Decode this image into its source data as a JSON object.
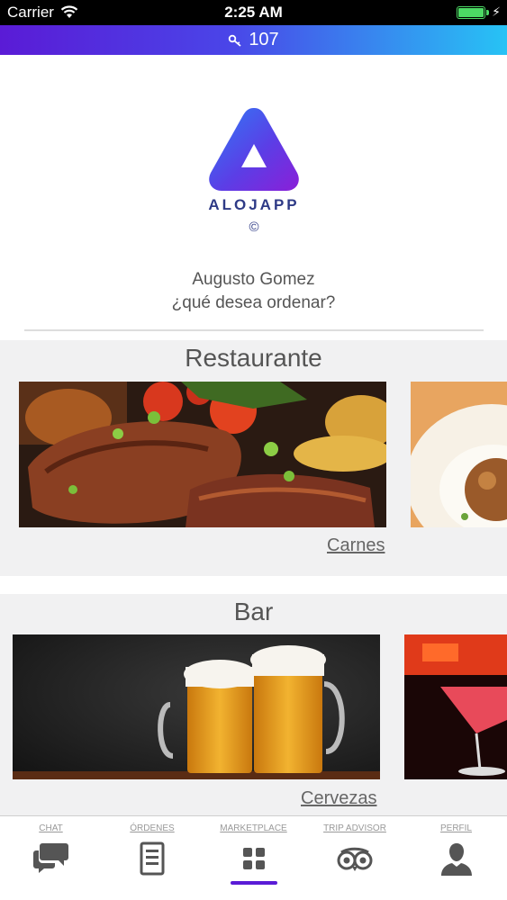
{
  "status_bar": {
    "carrier": "Carrier",
    "time": "2:25 AM"
  },
  "room_bar": {
    "icon": "key-icon",
    "room_number": "107"
  },
  "logo": {
    "brand_name": "ALOJAPP",
    "copyright": "©"
  },
  "greeting": {
    "user_name": "Augusto Gomez",
    "prompt": "¿qué desea ordenar?"
  },
  "sections": {
    "restaurante": {
      "title": "Restaurante",
      "card_label": "Carnes"
    },
    "bar": {
      "title": "Bar",
      "card_label": "Cervezas"
    }
  },
  "tab_bar": {
    "tabs": [
      {
        "label": "CHAT",
        "icon": "chat-icon"
      },
      {
        "label": "ÓRDENES",
        "icon": "document-icon"
      },
      {
        "label": "MARKETPLACE",
        "icon": "grid-icon",
        "active": true
      },
      {
        "label": "TRIP ADVISOR",
        "icon": "owl-icon"
      },
      {
        "label": "PERFIL",
        "icon": "user-icon"
      }
    ]
  },
  "colors": {
    "accent": "#5a1bd6",
    "gradient_end": "#27c3f5",
    "battery": "#4cd964",
    "section_bg": "#f1f1f2"
  }
}
